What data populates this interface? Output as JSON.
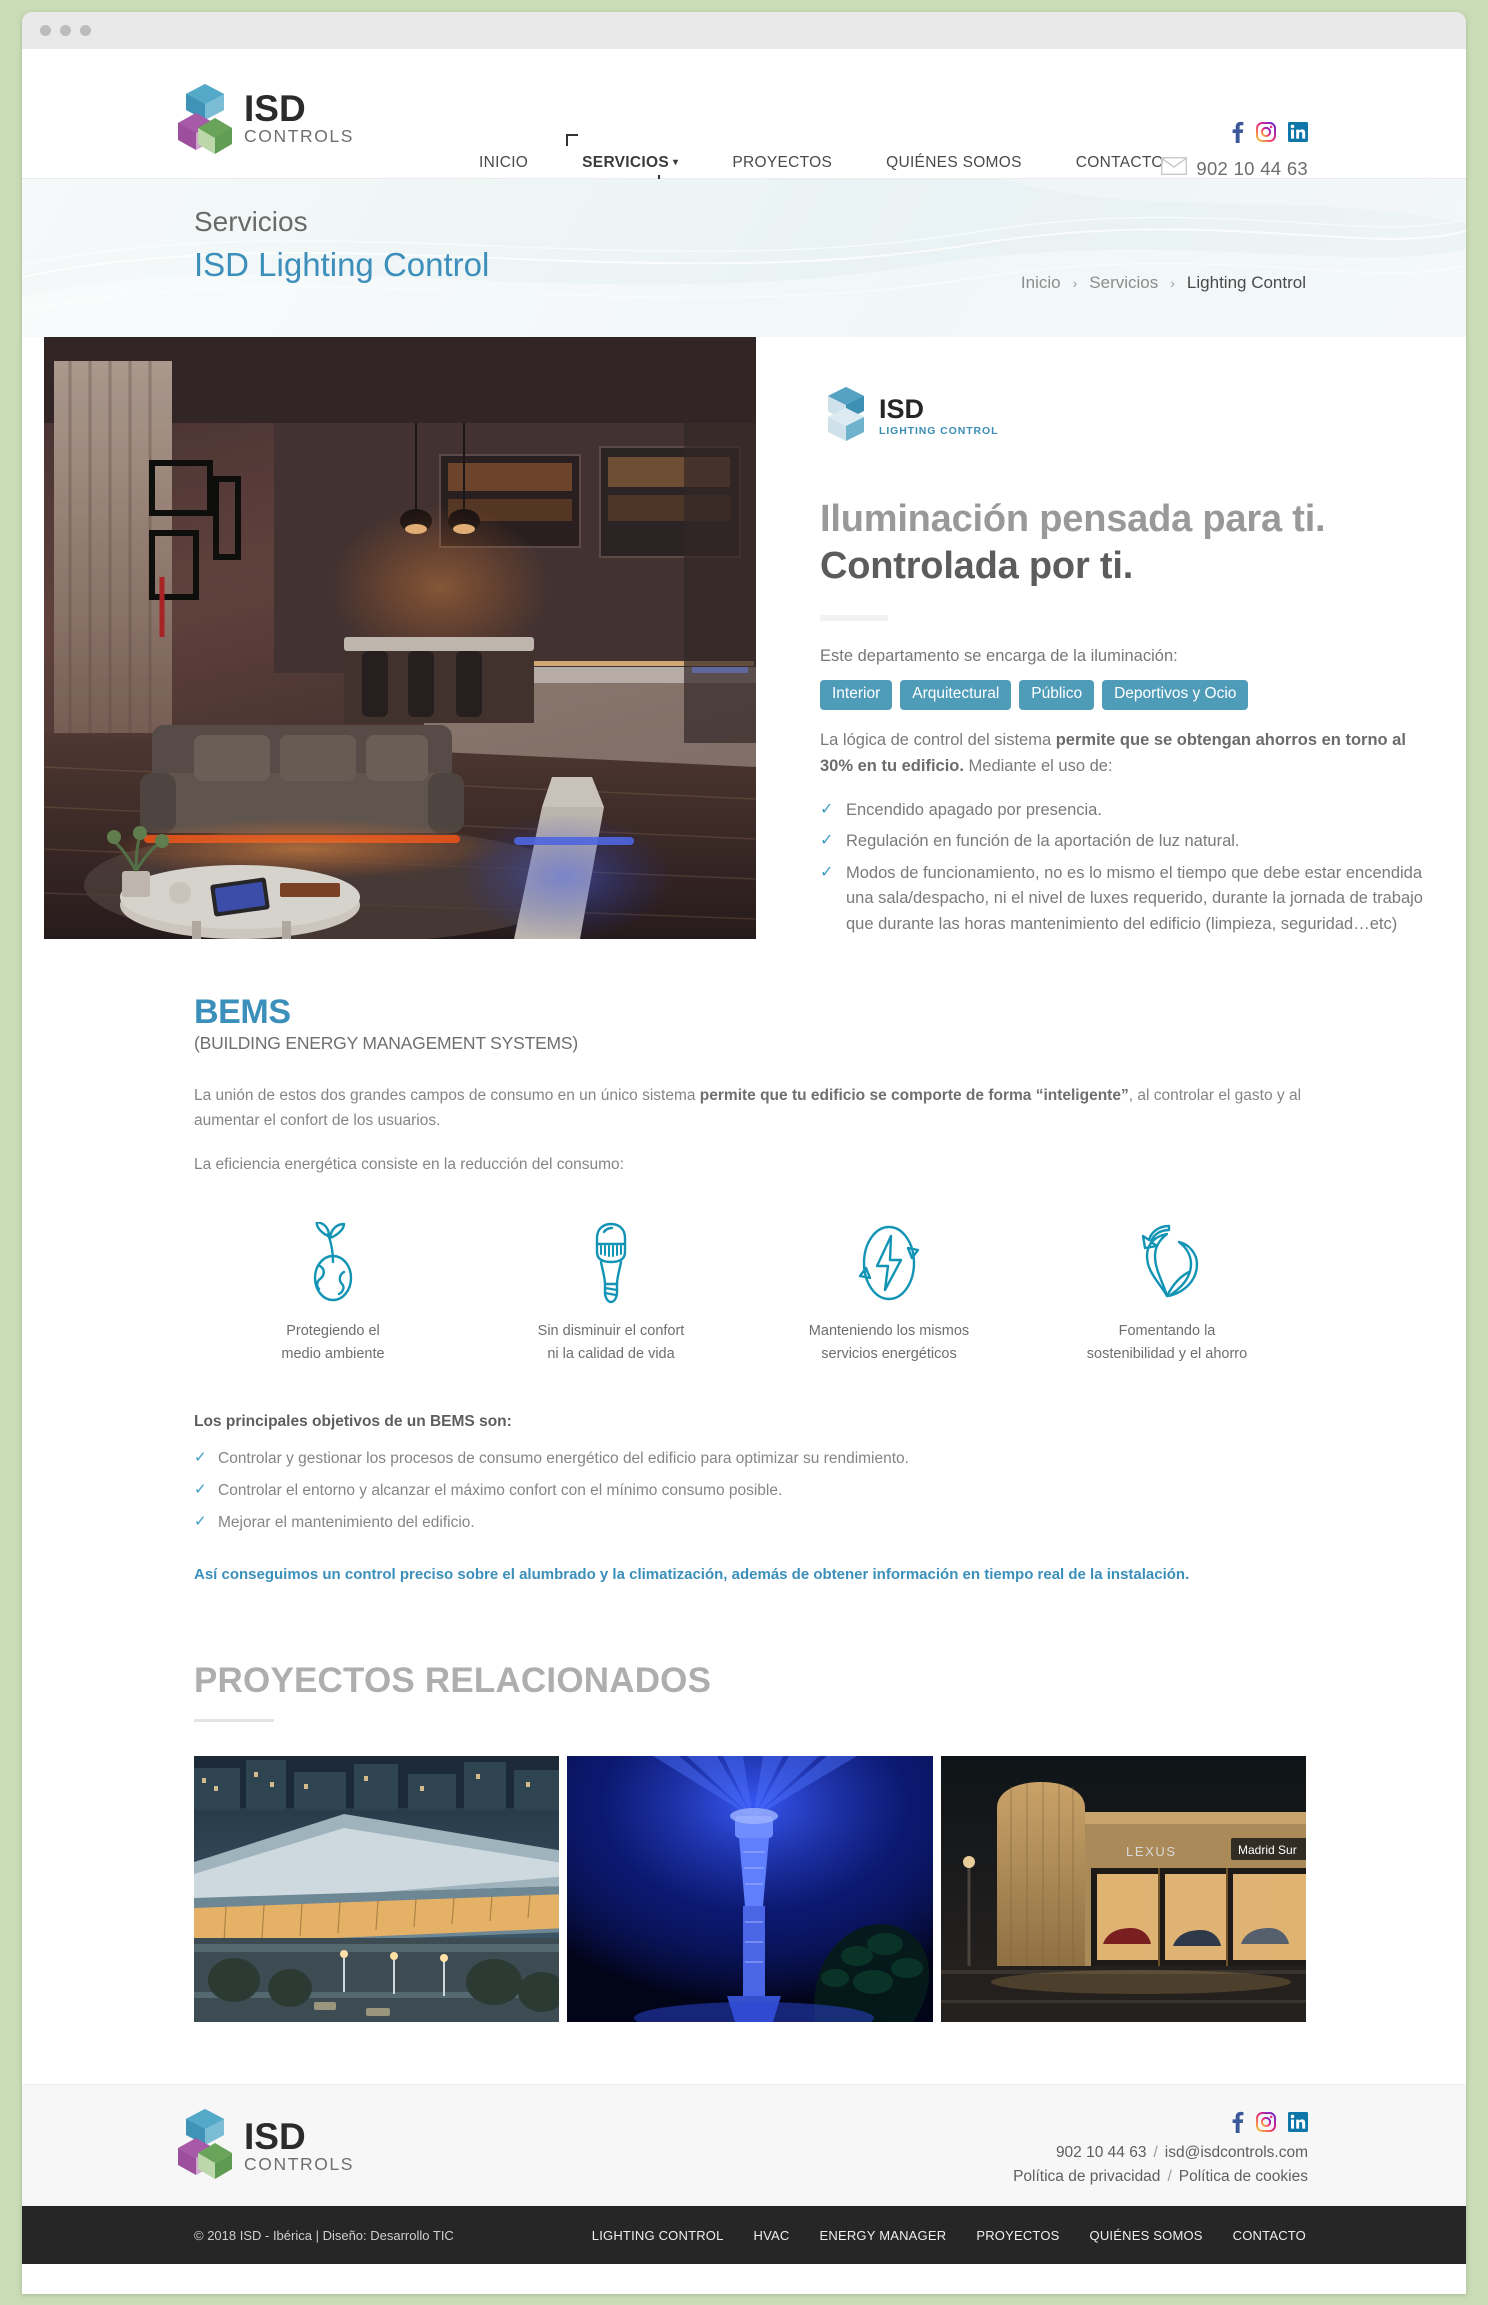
{
  "window": {
    "dots": 3
  },
  "header": {
    "logo": {
      "name": "ISD",
      "sub": "CONTROLS"
    },
    "nav": [
      {
        "label": "INICIO",
        "active": false,
        "caret": false
      },
      {
        "label": "SERVICIOS",
        "active": true,
        "caret": "▾"
      },
      {
        "label": "PROYECTOS",
        "active": false,
        "caret": false
      },
      {
        "label": "QUIÉNES SOMOS",
        "active": false,
        "caret": false
      },
      {
        "label": "CONTACTO",
        "active": false,
        "caret": false
      }
    ],
    "social": [
      "facebook-icon",
      "instagram-icon",
      "linkedin-icon"
    ],
    "phone": "902 10 44 63",
    "mail_icon": "envelope-icon"
  },
  "banner": {
    "eyebrow": "Servicios",
    "title": "ISD Lighting Control",
    "breadcrumb": [
      {
        "label": "Inicio",
        "current": false
      },
      {
        "label": "Servicios",
        "current": false
      },
      {
        "label": "Lighting Control",
        "current": true
      }
    ],
    "separator": "›"
  },
  "hero": {
    "image_alt": "interior-lighting-living-room-photo",
    "logo": {
      "name": "ISD",
      "sub": "LIGHTING CONTROL"
    },
    "heading_line1": "Iluminación pensada para ti.",
    "heading_line2": "Controlada por ti.",
    "lead": "Este departamento se encarga de la iluminación:",
    "pills": [
      "Interior",
      "Arquitectural",
      "Público",
      "Deportivos y Ocio"
    ],
    "para_pre": "La lógica de control del sistema ",
    "para_bold": "permite que se obtengan ahorros en torno al 30% en tu edificio.",
    "para_post": " Mediante el uso de:",
    "bullets": [
      "Encendido apagado por presencia.",
      "Regulación en función de la aportación de luz natural.",
      "Modos de funcionamiento, no es lo mismo el tiempo que debe estar encendida una sala/despacho, ni el nivel de luxes requerido, durante la jornada de trabajo que durante las horas mantenimiento del edificio (limpieza, seguridad…etc)"
    ],
    "check_glyph": "✓"
  },
  "bems": {
    "title": "BEMS",
    "subtitle": "(BUILDING ENERGY MANAGEMENT SYSTEMS)",
    "p1_pre": "La unión de estos dos grandes campos de consumo en un único sistema ",
    "p1_bold": "permite que tu edificio se comporte de forma “inteligente”",
    "p1_post": ", al controlar el gasto y al aumentar el confort de los usuarios.",
    "p2": "La eficiencia energética consiste en la reducción del consumo:",
    "features": [
      {
        "icon": "earth-leaf-icon",
        "line1": "Protegiendo el",
        "line2": "medio ambiente"
      },
      {
        "icon": "lightbulb-icon",
        "line1": "Sin disminuir el confort",
        "line2": "ni la calidad de vida"
      },
      {
        "icon": "energy-bolt-cycle-icon",
        "line1": "Manteniendo los mismos",
        "line2": "servicios energéticos"
      },
      {
        "icon": "recycle-leaf-icon",
        "line1": "Fomentando la",
        "line2": "sostenibilidad y el ahorro"
      }
    ],
    "objectives_title": "Los principales objetivos de un BEMS son:",
    "objectives": [
      "Controlar y gestionar los procesos de consumo energético del edificio para optimizar su rendimiento.",
      "Controlar el entorno y alcanzar el máximo confort con el mínimo consumo posible.",
      "Mejorar el mantenimiento del edificio."
    ],
    "closing": "Así conseguimos un control preciso sobre el alumbrado y la climatización, además de obtener información en tiempo real de la instalación.",
    "check_glyph": "✓"
  },
  "projects": {
    "title": "PROYECTOS RELACIONADOS",
    "items": [
      {
        "alt": "convention-center-night-photo"
      },
      {
        "alt": "blue-lit-tower-photo"
      },
      {
        "alt": "lexus-madrid-sur-dealership-photo",
        "sign1": "LEXUS",
        "sign2": "Madrid Sur"
      }
    ]
  },
  "footer": {
    "logo": {
      "name": "ISD",
      "sub": "CONTROLS"
    },
    "social": [
      "facebook-icon",
      "instagram-icon",
      "linkedin-icon"
    ],
    "phone": "902 10 44 63",
    "email": "isd@isdcontrols.com",
    "privacy": "Política de privacidad",
    "cookies": "Política de cookies",
    "slash": "/",
    "copyright": "© 2018 ISD - Ibérica | Diseño: Desarrollo TIC",
    "links": [
      "LIGHTING CONTROL",
      "HVAC",
      "ENERGY MANAGER",
      "PROYECTOS",
      "QUIÉNES SOMOS",
      "CONTACTO"
    ]
  },
  "colors": {
    "brand_blue": "#3b8fbb",
    "pill_blue": "#4f9cb9",
    "check_teal": "#3e9cc0",
    "dark_bar": "#262626",
    "page_bg": "#c9dcb5"
  }
}
